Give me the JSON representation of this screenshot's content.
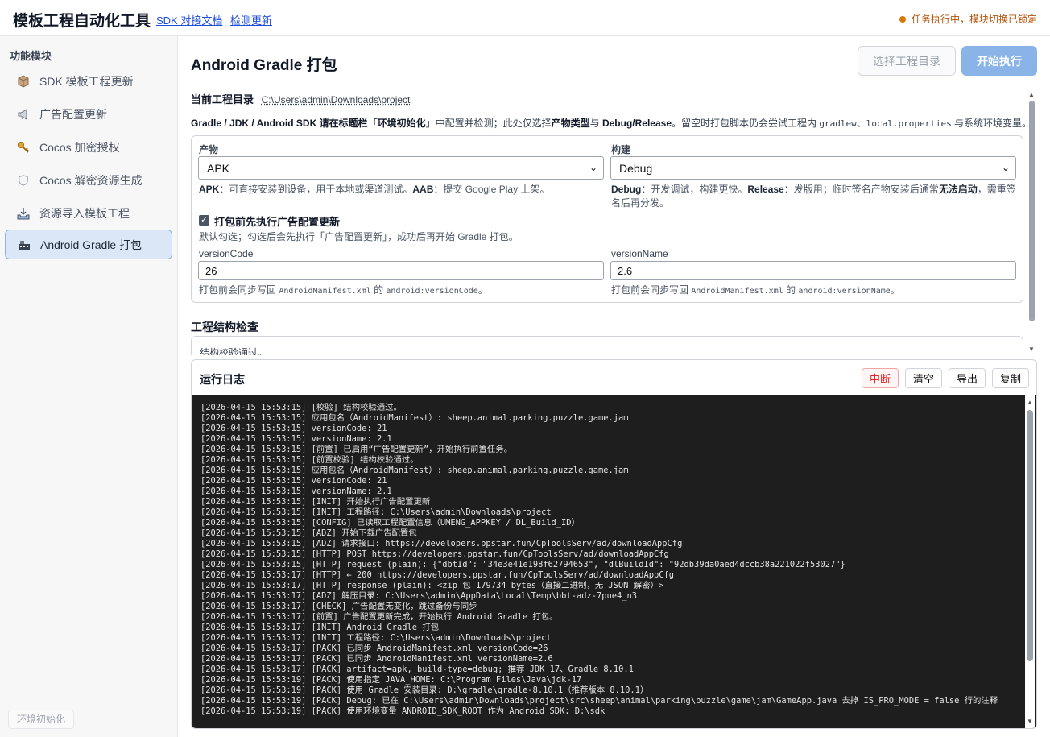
{
  "header": {
    "title": "模板工程自动化工具",
    "links": [
      "SDK 对接文档",
      "检测更新"
    ],
    "status": "任务执行中，模块切换已锁定"
  },
  "sidebar": {
    "heading": "功能模块",
    "items": [
      {
        "label": "SDK 模板工程更新",
        "icon": "package-icon"
      },
      {
        "label": "广告配置更新",
        "icon": "megaphone-icon"
      },
      {
        "label": "Cocos 加密授权",
        "icon": "key-icon"
      },
      {
        "label": "Cocos 解密资源生成",
        "icon": "shield-icon"
      },
      {
        "label": "资源导入模板工程",
        "icon": "import-tray-icon"
      },
      {
        "label": "Android Gradle 打包",
        "icon": "build-icon",
        "active": true
      }
    ],
    "env_button": "环境初始化"
  },
  "main": {
    "title": "Android Gradle 打包",
    "choose_dir_button": "选择工程目录",
    "start_button": "开始执行",
    "current_dir_label": "当前工程目录",
    "current_dir_path": "C:\\Users\\admin\\Downloads\\project",
    "hint": {
      "p1": "Gradle / JDK / Android SDK 请在标题栏「",
      "b1": "环境初始化",
      "p2": "」中配置并检测；此处仅选择",
      "b2": "产物类型",
      "p3": "与 ",
      "b3": "Debug/Release",
      "p4": "。留空时打包脚本仍会尝试工程内 ",
      "c1": "gradlew",
      "p5": "、",
      "c2": "local.properties",
      "p6": " 与系统环境变量。"
    },
    "artifact": {
      "label": "产物",
      "value": "APK",
      "desc_b1": "APK",
      "desc_p1": "：可直接安装到设备，用于本地或渠道测试。",
      "desc_b2": "AAB",
      "desc_p2": "：提交 Google Play 上架。"
    },
    "build": {
      "label": "构建",
      "value": "Debug",
      "desc_b1": "Debug",
      "desc_p1": "：开发调试，构建更快。",
      "desc_b2": "Release",
      "desc_p2": "：发版用；临时签名产物安装后通常",
      "desc_b3": "无法启动",
      "desc_p3": "，需重签",
      "desc_line2": "名后再分发。"
    },
    "pre_update": {
      "checked": true,
      "label": "打包前先执行广告配置更新",
      "desc": "默认勾选；勾选后会先执行「广告配置更新」，成功后再开始 Gradle 打包。"
    },
    "version_code": {
      "label": "versionCode",
      "value": "26",
      "desc_p1": "打包前会同步写回 ",
      "desc_c1": "AndroidManifest.xml",
      "desc_p2": " 的 ",
      "desc_c2": "android:versionCode",
      "desc_p3": "。"
    },
    "version_name": {
      "label": "versionName",
      "value": "2.6",
      "desc_p1": "打包前会同步写回 ",
      "desc_c1": "AndroidManifest.xml",
      "desc_p2": " 的 ",
      "desc_c2": "android:versionName",
      "desc_p3": "。"
    },
    "structure_check": {
      "title": "工程结构检查",
      "result": "结构校验通过。"
    }
  },
  "log": {
    "title": "运行日志",
    "buttons": {
      "abort": "中断",
      "clear": "清空",
      "export": "导出",
      "copy": "复制"
    },
    "lines": [
      "[2026-04-15 15:53:15] [校验] 结构校验通过。",
      "[2026-04-15 15:53:15] 应用包名（AndroidManifest）: sheep.animal.parking.puzzle.game.jam",
      "[2026-04-15 15:53:15] versionCode: 21",
      "[2026-04-15 15:53:15] versionName: 2.1",
      "[2026-04-15 15:53:15] [前置] 已启用“广告配置更新”，开始执行前置任务。",
      "[2026-04-15 15:53:15] [前置校验] 结构校验通过。",
      "[2026-04-15 15:53:15] 应用包名（AndroidManifest）: sheep.animal.parking.puzzle.game.jam",
      "[2026-04-15 15:53:15] versionCode: 21",
      "[2026-04-15 15:53:15] versionName: 2.1",
      "[2026-04-15 15:53:15] [INIT] 开始执行广告配置更新",
      "[2026-04-15 15:53:15] [INIT] 工程路径: C:\\Users\\admin\\Downloads\\project",
      "[2026-04-15 15:53:15] [CONFIG] 已读取工程配置信息（UMENG_APPKEY / DL_Build_ID）",
      "[2026-04-15 15:53:15] [ADZ] 开始下载广告配置包",
      "[2026-04-15 15:53:15] [ADZ] 请求接口: https://developers.ppstar.fun/CpToolsServ/ad/downloadAppCfg",
      "[2026-04-15 15:53:15] [HTTP] POST https://developers.ppstar.fun/CpToolsServ/ad/downloadAppCfg",
      "[2026-04-15 15:53:15] [HTTP] request (plain): {\"dbtId\": \"34e3e41e198f62794653\", \"dlBuildId\": \"92db39da0aed4dccb38a221022f53027\"}",
      "[2026-04-15 15:53:17] [HTTP] ← 200 https://developers.ppstar.fun/CpToolsServ/ad/downloadAppCfg",
      "[2026-04-15 15:53:17] [HTTP] response (plain): <zip 包 179734 bytes（直接二进制，无 JSON 解密）>",
      "[2026-04-15 15:53:17] [ADZ] 解压目录: C:\\Users\\admin\\AppData\\Local\\Temp\\bbt-adz-7pue4_n3",
      "[2026-04-15 15:53:17] [CHECK] 广告配置无变化，跳过备份与同步",
      "[2026-04-15 15:53:17] [前置] 广告配置更新完成，开始执行 Android Gradle 打包。",
      "[2026-04-15 15:53:17] [INIT] Android Gradle 打包",
      "[2026-04-15 15:53:17] [INIT] 工程路径: C:\\Users\\admin\\Downloads\\project",
      "[2026-04-15 15:53:17] [PACK] 已同步 AndroidManifest.xml versionCode=26",
      "[2026-04-15 15:53:17] [PACK] 已同步 AndroidManifest.xml versionName=2.6",
      "[2026-04-15 15:53:17] [PACK] artifact=apk, build-type=debug; 推荐 JDK 17、Gradle 8.10.1",
      "[2026-04-15 15:53:19] [PACK] 使用指定 JAVA_HOME: C:\\Program Files\\Java\\jdk-17",
      "[2026-04-15 15:53:19] [PACK] 使用 Gradle 安装目录: D:\\gradle\\gradle-8.10.1（推荐版本 8.10.1）",
      "[2026-04-15 15:53:19] [PACK] Debug: 已在 C:\\Users\\admin\\Downloads\\project\\src\\sheep\\animal\\parking\\puzzle\\game\\jam\\GameApp.java 去掉 IS_PRO_MODE = false 行的注释",
      "[2026-04-15 15:53:19] [PACK] 使用环境变量 ANDROID_SDK_ROOT 作为 Android SDK: D:\\sdk"
    ]
  }
}
